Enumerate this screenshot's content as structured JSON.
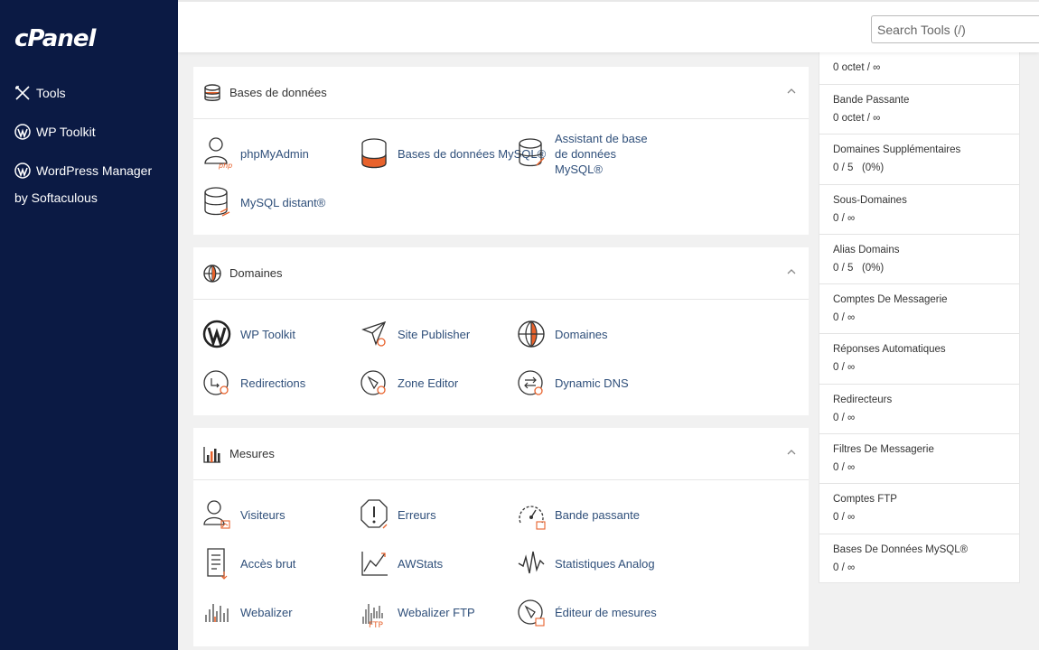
{
  "sidebar": {
    "logo": "cPanel",
    "items": [
      {
        "label": "Tools"
      },
      {
        "label": "WP Toolkit"
      },
      {
        "label": "WordPress Manager by Softaculous"
      }
    ]
  },
  "search": {
    "placeholder": "Search Tools (/)"
  },
  "sections": {
    "databases": {
      "title": "Bases de données",
      "items": [
        {
          "label": "phpMyAdmin"
        },
        {
          "label": "Bases de données MySQL®"
        },
        {
          "label": "Assistant de base de données MySQL®"
        },
        {
          "label": "MySQL distant®"
        }
      ]
    },
    "domains": {
      "title": "Domaines",
      "items": [
        {
          "label": "WP Toolkit"
        },
        {
          "label": "Site Publisher"
        },
        {
          "label": "Domaines"
        },
        {
          "label": "Redirections"
        },
        {
          "label": "Zone Editor"
        },
        {
          "label": "Dynamic DNS"
        }
      ]
    },
    "metrics": {
      "title": "Mesures",
      "items": [
        {
          "label": "Visiteurs"
        },
        {
          "label": "Erreurs"
        },
        {
          "label": "Bande passante"
        },
        {
          "label": "Accès brut"
        },
        {
          "label": "AWStats"
        },
        {
          "label": "Statistiques Analog"
        },
        {
          "label": "Webalizer"
        },
        {
          "label": "Webalizer FTP"
        },
        {
          "label": "Éditeur de mesures"
        }
      ]
    }
  },
  "stats": [
    {
      "label": "",
      "value": "0 octet / ∞"
    },
    {
      "label": "Bande Passante",
      "value": "0 octet / ∞"
    },
    {
      "label": "Domaines Supplémentaires",
      "value": "0 / 5   (0%)"
    },
    {
      "label": "Sous-Domaines",
      "value": "0 / ∞"
    },
    {
      "label": "Alias Domains",
      "value": "0 / 5   (0%)"
    },
    {
      "label": "Comptes De Messagerie",
      "value": "0 / ∞"
    },
    {
      "label": "Réponses Automatiques",
      "value": "0 / ∞"
    },
    {
      "label": "Redirecteurs",
      "value": "0 / ∞"
    },
    {
      "label": "Filtres De Messagerie",
      "value": "0 / ∞"
    },
    {
      "label": "Comptes FTP",
      "value": "0 / ∞"
    },
    {
      "label": "Bases De Données MySQL®",
      "value": "0 / ∞"
    }
  ],
  "colors": {
    "sidebar": "#0b1a44",
    "accent": "#e8622c",
    "link": "#2f4f7a"
  }
}
